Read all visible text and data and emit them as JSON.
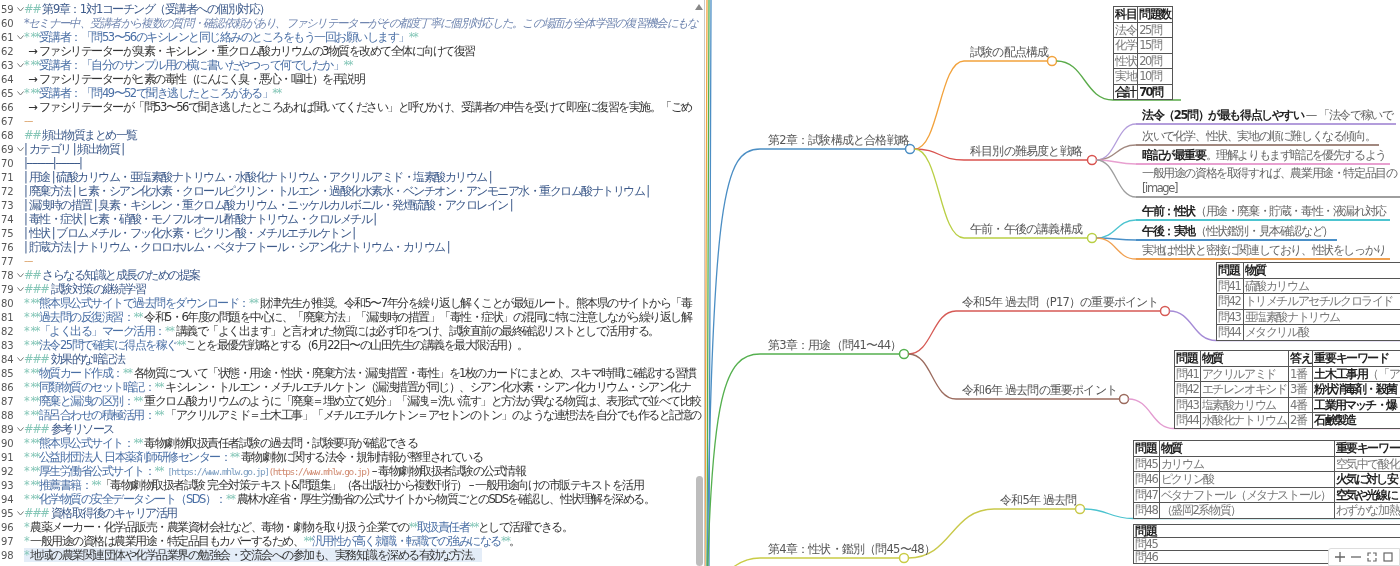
{
  "editor": {
    "lines": [
      {
        "num": "59",
        "foldable": true,
        "current": false,
        "segments": [
          {
            "kind": "mark",
            "text": "##"
          },
          {
            "kind": "head",
            "text": " 第9章：1対1コーチング（受講者への個別対応）"
          }
        ]
      },
      {
        "num": "60",
        "foldable": false,
        "current": false,
        "segments": [
          {
            "kind": "italic",
            "text": "*セミナー中、受講者から複数の質問・確認依頼があり、ファシリテーターがその都度丁寧に個別対応した。この場面が全体学習の復習機会にもな"
          }
        ]
      },
      {
        "num": "61",
        "foldable": true,
        "current": false,
        "segments": [
          {
            "kind": "mark",
            "text": "* **"
          },
          {
            "kind": "bold",
            "text": "受講者：「問53〜56のキシレンと同じ絡みのところをもう一回お願いします」"
          },
          {
            "kind": "mark",
            "text": "**"
          }
        ]
      },
      {
        "num": "62",
        "foldable": false,
        "current": false,
        "segments": [
          {
            "kind": "text",
            "text": "  → ファシリテーターが臭素・キシレン・重クロム酸カリウムの3物質を改めて全体に向けて復習"
          }
        ]
      },
      {
        "num": "63",
        "foldable": true,
        "current": false,
        "segments": [
          {
            "kind": "mark",
            "text": "* **"
          },
          {
            "kind": "bold",
            "text": "受講者：「自分のサンプル用の横に書いたやつって何でしたか」"
          },
          {
            "kind": "mark",
            "text": "**"
          }
        ]
      },
      {
        "num": "64",
        "foldable": false,
        "current": false,
        "segments": [
          {
            "kind": "text",
            "text": "  → ファシリテーターがヒ素の毒性（にんにく臭・悪心・嘔吐）を再説明"
          }
        ]
      },
      {
        "num": "65",
        "foldable": true,
        "current": false,
        "segments": [
          {
            "kind": "mark",
            "text": "* **"
          },
          {
            "kind": "bold",
            "text": "受講者：「問49〜52で聞き逃したところがある」"
          },
          {
            "kind": "mark",
            "text": "**"
          }
        ]
      },
      {
        "num": "66",
        "foldable": false,
        "current": false,
        "segments": [
          {
            "kind": "text",
            "text": "  → ファシリテーターが「問53〜56で聞き逃したところあれば聞いてください」と呼びかけ、受講者の申告を受けて即座に復習を実施。「ごめ"
          }
        ]
      },
      {
        "num": "67",
        "foldable": false,
        "current": false,
        "segments": [
          {
            "kind": "rule",
            "text": "---"
          }
        ]
      },
      {
        "num": "68",
        "foldable": false,
        "current": false,
        "segments": [
          {
            "kind": "mark",
            "text": "##"
          },
          {
            "kind": "head",
            "text": " 頻出物質まとめ一覧"
          }
        ]
      },
      {
        "num": "69",
        "foldable": true,
        "current": false,
        "segments": [
          {
            "kind": "table",
            "text": "| カテゴリ | 頻出物質 |"
          }
        ]
      },
      {
        "num": "70",
        "foldable": false,
        "current": false,
        "segments": [
          {
            "kind": "table",
            "text": "|----------|---------|"
          }
        ]
      },
      {
        "num": "71",
        "foldable": false,
        "current": false,
        "segments": [
          {
            "kind": "table",
            "text": "| 用途 | 硫酸カリウム・亜塩素酸ナトリウム・水酸化ナトリウム・アクリルアミド・塩素酸カリウム |"
          }
        ]
      },
      {
        "num": "72",
        "foldable": false,
        "current": false,
        "segments": [
          {
            "kind": "table",
            "text": "| 廃棄方法 | ヒ素・シアン化水素・クロールピクリン・トルエン・過酸化水素水・ベンチオン・アンモニア水・重クロム酸ナトリウム |"
          }
        ]
      },
      {
        "num": "73",
        "foldable": false,
        "current": false,
        "segments": [
          {
            "kind": "table",
            "text": "| 漏洩時の措置 | 臭素・キシレン・重クロム酸カリウム・ニッケルカルボニル・発煙硫酸・アクロレイン |"
          }
        ]
      },
      {
        "num": "74",
        "foldable": false,
        "current": false,
        "segments": [
          {
            "kind": "table",
            "text": "| 毒性・症状 | ヒ素・硝酸・モノフルオール酢酸ナトリウム・クロルメチル |"
          }
        ]
      },
      {
        "num": "75",
        "foldable": false,
        "current": false,
        "segments": [
          {
            "kind": "table",
            "text": "| 性状 | ブロムメチル・フッ化水素・ピクリン酸・メチルエチルケトン |"
          }
        ]
      },
      {
        "num": "76",
        "foldable": false,
        "current": false,
        "segments": [
          {
            "kind": "table",
            "text": "| 貯蔵方法 | ナトリウム・クロロホルム・ベタナフトール・シアン化ナトリウム・カリウム |"
          }
        ]
      },
      {
        "num": "77",
        "foldable": false,
        "current": false,
        "segments": [
          {
            "kind": "rule",
            "text": "---"
          }
        ]
      },
      {
        "num": "78",
        "foldable": true,
        "current": false,
        "segments": [
          {
            "kind": "mark",
            "text": "##"
          },
          {
            "kind": "head",
            "text": " さらなる知識と成長のための提案"
          }
        ]
      },
      {
        "num": "79",
        "foldable": true,
        "current": false,
        "segments": [
          {
            "kind": "mark",
            "text": "###"
          },
          {
            "kind": "head",
            "text": " 試験対策の継続学習"
          }
        ]
      },
      {
        "num": "80",
        "foldable": false,
        "current": false,
        "segments": [
          {
            "kind": "mark",
            "text": "* **"
          },
          {
            "kind": "bold",
            "text": "熊本県公式サイトで過去問をダウンロード："
          },
          {
            "kind": "mark",
            "text": "**"
          },
          {
            "kind": "text",
            "text": " 財津先生が推奨。令和5〜7年分を繰り返し解くことが最短ルート。熊本県のサイトから「毒"
          }
        ]
      },
      {
        "num": "81",
        "foldable": false,
        "current": false,
        "segments": [
          {
            "kind": "mark",
            "text": "* **"
          },
          {
            "kind": "bold",
            "text": "過去問の反復演習："
          },
          {
            "kind": "mark",
            "text": "**"
          },
          {
            "kind": "text",
            "text": " 令和5・6年度の問題を中心に、「廃棄方法」「漏洩時の措置」「毒性・症状」の混同に特に注意しながら繰り返し解"
          }
        ]
      },
      {
        "num": "82",
        "foldable": false,
        "current": false,
        "segments": [
          {
            "kind": "mark",
            "text": "* **"
          },
          {
            "kind": "bold",
            "text": "「よく出る」マーク活用："
          },
          {
            "kind": "mark",
            "text": "**"
          },
          {
            "kind": "text",
            "text": " 講義で「よく出ます」と言われた物質には必ず印をつけ、試験直前の最終確認リストとして活用する。"
          }
        ]
      },
      {
        "num": "83",
        "foldable": false,
        "current": false,
        "segments": [
          {
            "kind": "mark",
            "text": "* **"
          },
          {
            "kind": "bold",
            "text": "法令25問で確実に得点を稼ぐ"
          },
          {
            "kind": "mark",
            "text": "**"
          },
          {
            "kind": "text",
            "text": "ことを最優先戦略とする（6月22日〜の山田先生の講義を最大限活用）。"
          }
        ]
      },
      {
        "num": "84",
        "foldable": true,
        "current": false,
        "segments": [
          {
            "kind": "mark",
            "text": "###"
          },
          {
            "kind": "head",
            "text": " 効果的な暗記法"
          }
        ]
      },
      {
        "num": "85",
        "foldable": false,
        "current": false,
        "segments": [
          {
            "kind": "mark",
            "text": "* **"
          },
          {
            "kind": "bold",
            "text": "物質カード作成："
          },
          {
            "kind": "mark",
            "text": "**"
          },
          {
            "kind": "text",
            "text": " 各物質について「状態・用途・性状・廃棄方法・漏洩措置・毒性」を1枚のカードにまとめ、スキマ時間に確認する習慣"
          }
        ]
      },
      {
        "num": "86",
        "foldable": false,
        "current": false,
        "segments": [
          {
            "kind": "mark",
            "text": "* **"
          },
          {
            "kind": "bold",
            "text": "同類物質のセット暗記："
          },
          {
            "kind": "mark",
            "text": "**"
          },
          {
            "kind": "text",
            "text": " キシレン・トルエン・メチルエチルケトン（漏洩措置が同じ）、シアン化水素・シアン化カリウム・シアン化ナ"
          }
        ]
      },
      {
        "num": "87",
        "foldable": false,
        "current": false,
        "segments": [
          {
            "kind": "mark",
            "text": "* **"
          },
          {
            "kind": "bold",
            "text": "廃棄と漏洩の区別："
          },
          {
            "kind": "mark",
            "text": "**"
          },
          {
            "kind": "text",
            "text": " 重クロム酸カリウムのように「廃棄＝埋め立て処分」「漏洩＝洗い流す」と方法が異なる物質は、表形式で並べて比較"
          }
        ]
      },
      {
        "num": "88",
        "foldable": false,
        "current": false,
        "segments": [
          {
            "kind": "mark",
            "text": "* **"
          },
          {
            "kind": "bold",
            "text": "語呂合わせの積極活用："
          },
          {
            "kind": "mark",
            "text": "**"
          },
          {
            "kind": "text",
            "text": " 「アクリルアミド＝土木工事」「メチルエチルケトン＝アセトンのトン」のような連想法を自分でも作ると記憶の"
          }
        ]
      },
      {
        "num": "89",
        "foldable": true,
        "current": false,
        "segments": [
          {
            "kind": "mark",
            "text": "###"
          },
          {
            "kind": "head",
            "text": " 参考リソース"
          }
        ]
      },
      {
        "num": "90",
        "foldable": false,
        "current": false,
        "segments": [
          {
            "kind": "mark",
            "text": "* **"
          },
          {
            "kind": "bold",
            "text": "熊本県公式サイト："
          },
          {
            "kind": "mark",
            "text": "**"
          },
          {
            "kind": "text",
            "text": " 毒物劇物取扱責任者試験の過去問・試験要項が確認できる"
          }
        ]
      },
      {
        "num": "91",
        "foldable": false,
        "current": false,
        "segments": [
          {
            "kind": "mark",
            "text": "* **"
          },
          {
            "kind": "bold",
            "text": "公益財団法人 日本薬剤師研修センター："
          },
          {
            "kind": "mark",
            "text": "**"
          },
          {
            "kind": "text",
            "text": " 毒物劇物に関する法令・規制情報が整理されている"
          }
        ]
      },
      {
        "num": "92",
        "foldable": false,
        "current": false,
        "segments": [
          {
            "kind": "mark",
            "text": "* **"
          },
          {
            "kind": "bold",
            "text": "厚生労働省公式サイト："
          },
          {
            "kind": "mark",
            "text": "**"
          },
          {
            "kind": "link",
            "text": " [https://www.mhlw.go.jp]"
          },
          {
            "kind": "url",
            "text": "(https://www.mhlw.go.jp)"
          },
          {
            "kind": "text",
            "text": " – 毒物劇物取扱者試験の公式情報"
          }
        ]
      },
      {
        "num": "93",
        "foldable": false,
        "current": false,
        "segments": [
          {
            "kind": "mark",
            "text": "* **"
          },
          {
            "kind": "bold",
            "text": "推薦書籍："
          },
          {
            "kind": "mark",
            "text": "**"
          },
          {
            "kind": "text",
            "text": "「毒物劇物取扱者試験 完全対策テキスト&問題集」（各出版社から複数刊行） – 一般用途向けの市販テキストを活用"
          }
        ]
      },
      {
        "num": "94",
        "foldable": false,
        "current": false,
        "segments": [
          {
            "kind": "mark",
            "text": "* **"
          },
          {
            "kind": "bold",
            "text": "化学物質の安全データシート（SDS）："
          },
          {
            "kind": "mark",
            "text": "**"
          },
          {
            "kind": "text",
            "text": " 農林水産省・厚生労働省の公式サイトから物質ごとのSDSを確認し、性状理解を深める。"
          }
        ]
      },
      {
        "num": "95",
        "foldable": true,
        "current": false,
        "segments": [
          {
            "kind": "mark",
            "text": "###"
          },
          {
            "kind": "head",
            "text": " 資格取得後のキャリア活用"
          }
        ]
      },
      {
        "num": "96",
        "foldable": false,
        "current": false,
        "segments": [
          {
            "kind": "mark",
            "text": "* "
          },
          {
            "kind": "text",
            "text": "農薬メーカー・化学品販売・農業資材会社など、毒物・劇物を取り扱う企業での"
          },
          {
            "kind": "mark",
            "text": "**"
          },
          {
            "kind": "bold",
            "text": "取扱責任者"
          },
          {
            "kind": "mark",
            "text": "**"
          },
          {
            "kind": "text",
            "text": "として活躍できる。"
          }
        ]
      },
      {
        "num": "97",
        "foldable": false,
        "current": false,
        "segments": [
          {
            "kind": "mark",
            "text": "* "
          },
          {
            "kind": "text",
            "text": "一般用途の資格は農業用途・特定品目もカバーするため、"
          },
          {
            "kind": "mark",
            "text": "**"
          },
          {
            "kind": "bold",
            "text": "汎用性が高く就職・転職での強みになる"
          },
          {
            "kind": "mark",
            "text": "**"
          },
          {
            "kind": "text",
            "text": "。"
          }
        ]
      },
      {
        "num": "98",
        "foldable": false,
        "current": true,
        "segments": [
          {
            "kind": "mark",
            "text": "* "
          },
          {
            "kind": "text",
            "text": "地域の農業関連団体や化学品業界の勉強会・交流会への参加も、実務知識を深める有効な方法。"
          }
        ]
      }
    ]
  },
  "mindmap": {
    "chapters": [
      {
        "label": "第2章：試験構成と合格戦略",
        "color": "#4b8ec4",
        "children": [
          {
            "label": "試験の配点構成",
            "color": "#f2a23c",
            "table": {
              "kind": "totals",
              "color": "#5aab4a",
              "columns": [
                "科目",
                "問題数"
              ],
              "rows": [
                {
                  "cells": [
                    "法令",
                    "25問"
                  ],
                  "bold": false
                },
                {
                  "cells": [
                    "化学",
                    "15問"
                  ],
                  "bold": false
                },
                {
                  "cells": [
                    "性状",
                    "20問"
                  ],
                  "bold": false
                },
                {
                  "cells": [
                    "実地",
                    "10問"
                  ],
                  "bold": false
                },
                {
                  "cells": [
                    "合計",
                    "70問"
                  ],
                  "bold": true
                }
              ]
            }
          },
          {
            "label": "科目別の難易度と戦略",
            "color": "#d9534f",
            "notes": [
              {
                "color": "#b39ddb",
                "lines": [
                  "**法令（25問）が最も得点しやすい** — 「法令で稼いで"
                ]
              },
              {
                "color": "#a1887f",
                "lines": [
                  "次いで化学、性状、実地の順に難しくなる傾向。"
                ]
              },
              {
                "color": "#e8a0d0",
                "lines": [
                  "**暗記が最重要**。理解よりもまず暗記を優先するよう"
                ]
              },
              {
                "color": "#9e9e9e",
                "lines": [
                  "一般用途の資格を取得すれば、農業用途・特定品目の",
                  "[image]"
                ]
              }
            ]
          },
          {
            "label": "午前・午後の講義構成",
            "color": "#b9cf45",
            "notes": [
              {
                "color": "#4dc4d0",
                "lines": [
                  "**午前：性状**（用途・廃棄・貯蔵・毒性・液漏れ対応"
                ]
              },
              {
                "color": "#4a90c8",
                "lines": [
                  "**午後：実地**（性状鑑別・見本確認など）"
                ]
              },
              {
                "color": "#f0a050",
                "lines": [
                  "実地は性状と密接に関連しており、性状をしっかり"
                ]
              }
            ]
          }
        ]
      },
      {
        "label": "第3章：用途（問41〜44）",
        "color": "#55b04f",
        "children": [
          {
            "label": "令和5年 過去問（P17）の重要ポイント",
            "color": "#d65a55",
            "table": {
              "kind": "keywords",
              "color": "#a58bd6",
              "columns": [
                "問題",
                "物質"
              ],
              "rows": [
                {
                  "cells": [
                    "問41",
                    "硫酸カリウム"
                  ],
                  "bold": false
                },
                {
                  "cells": [
                    "問42",
                    "トリメチルアセチルクロライド"
                  ],
                  "bold": false
                },
                {
                  "cells": [
                    "問43",
                    "亜塩素酸ナトリウム"
                  ],
                  "bold": false
                },
                {
                  "cells": [
                    "問44",
                    "メタクリル酸"
                  ],
                  "bold": false
                }
              ]
            }
          },
          {
            "label": "令和6年 過去問の重要ポイント",
            "color": "#9b6b5e",
            "table": {
              "kind": "keywords",
              "color": "#e39bd0",
              "columns": [
                "問題",
                "物質",
                "答え",
                "重要キーワード"
              ],
              "rows": [
                {
                  "cells": [
                    "問41",
                    "アクリルアミド",
                    "1番",
                    "**土木工事用**（「ア"
                  ],
                  "bold": false
                },
                {
                  "cells": [
                    "問42",
                    "エチレンオキシド",
                    "3番",
                    "粉状消毒剤・殺菌"
                  ],
                  "bold": true
                },
                {
                  "cells": [
                    "問43",
                    "塩素酸カリウム",
                    "4番",
                    "工業用マッチ・爆"
                  ],
                  "bold": true
                },
                {
                  "cells": [
                    "問44",
                    "水酸化ナトリウム",
                    "2番",
                    "石鹸製造"
                  ],
                  "bold": true
                }
              ]
            }
          }
        ]
      },
      {
        "label": "第4章：性状・鑑別（問45〜48）",
        "color": "#c9cc45",
        "children": [
          {
            "label": "令和5年 過去問",
            "color": "#c9c94a",
            "table": {
              "kind": "keywords",
              "color": "#4cc3cf",
              "columns": [
                "問題",
                "物質",
                "重要キーワー"
              ],
              "rows": [
                {
                  "cells": [
                    "問45",
                    "カリウム",
                    "空気中で酸化"
                  ],
                  "bold": false
                },
                {
                  "cells": [
                    "問46",
                    "ピクリン酸",
                    "火気に対し安"
                  ],
                  "bold": true
                },
                {
                  "cells": [
                    "問47",
                    "ベタナフトール（メタナストール）",
                    "空気や光線に"
                  ],
                  "bold": true
                },
                {
                  "cells": [
                    "問48",
                    "（盛岡2系物質）",
                    "わずかな加熱"
                  ],
                  "bold": false
                }
              ]
            }
          }
        ]
      }
    ],
    "loose_tables": [
      {
        "kind": "keywords",
        "columns": [
          "問題"
        ],
        "rows": [
          {
            "cells": [
              "問45"
            ],
            "bold": false
          },
          {
            "cells": [
              "問46"
            ],
            "bold": false
          }
        ]
      }
    ]
  }
}
